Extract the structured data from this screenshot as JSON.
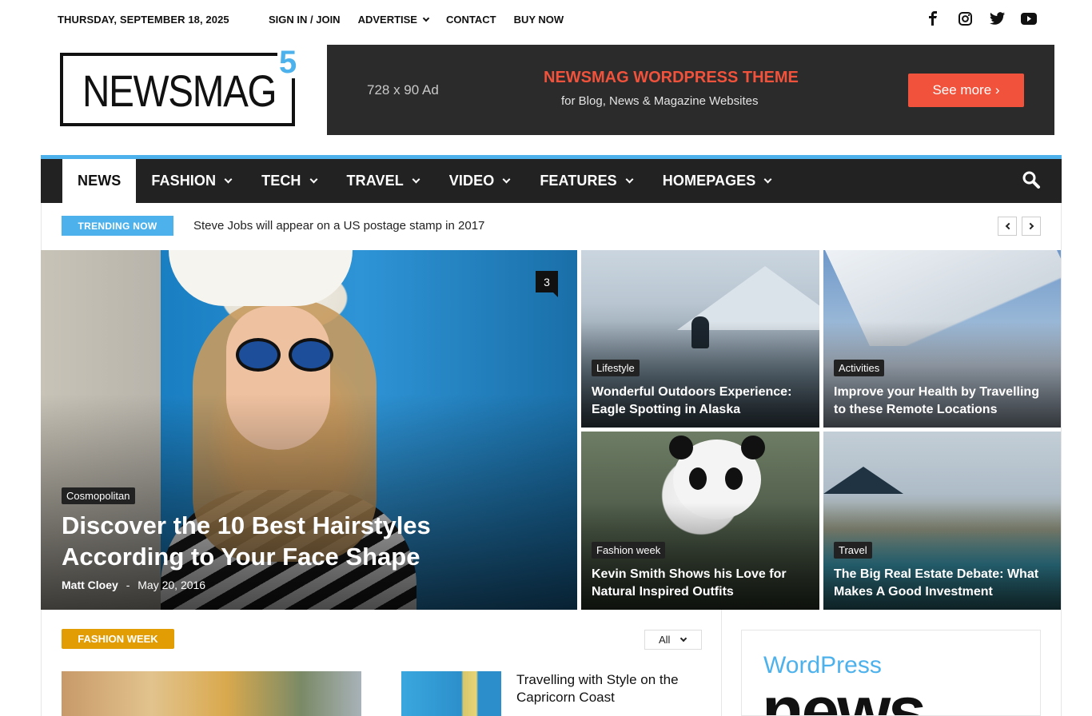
{
  "topbar": {
    "date": "THURSDAY, SEPTEMBER 18, 2025",
    "menu": [
      "SIGN IN / JOIN",
      "ADVERTISE",
      "CONTACT",
      "BUY NOW"
    ],
    "social": [
      "facebook-icon",
      "instagram-icon",
      "twitter-icon",
      "youtube-icon"
    ]
  },
  "logo": {
    "text": "NEWSMAG",
    "version": "5"
  },
  "ad": {
    "size_label": "728 x 90 Ad",
    "headline": "NEWSMAG WORDPRESS THEME",
    "subline": "for Blog, News & Magazine Websites",
    "button": "See more ›"
  },
  "nav": {
    "items": [
      "NEWS",
      "FASHION",
      "TECH",
      "TRAVEL",
      "VIDEO",
      "FEATURES",
      "HOMEPAGES"
    ],
    "active": "NEWS"
  },
  "trending": {
    "label": "TRENDING NOW",
    "headline": "Steve Jobs will appear on a US postage stamp in 2017"
  },
  "featured": {
    "big": {
      "category": "Cosmopolitan",
      "title": "Discover the 10 Best Hairstyles According to Your Face Shape",
      "author": "Matt Cloey",
      "separator": "-",
      "date": "May 20, 2016",
      "comments": "3"
    },
    "tiles": [
      {
        "category": "Lifestyle",
        "title": "Wonderful Outdoors Experience: Eagle Spotting in Alaska"
      },
      {
        "category": "Activities",
        "title": "Improve your Health by Travelling to these Remote Locations"
      },
      {
        "category": "Fashion week",
        "title": "Kevin Smith Shows his Love for Natural Inspired Outfits"
      },
      {
        "category": "Travel",
        "title": "The Big Real Estate Debate: What Makes A Good Investment"
      }
    ]
  },
  "section": {
    "label": "FASHION WEEK",
    "filter": "All",
    "side_title": "Travelling with Style on the Capricorn Coast"
  },
  "sidebar_ad": {
    "brand": "WordPress",
    "word": "news"
  },
  "colors": {
    "accent": "#4db2ec",
    "ad_red": "#f0523b",
    "fashion_week": "#e29c04",
    "nav_bg": "#222222"
  }
}
